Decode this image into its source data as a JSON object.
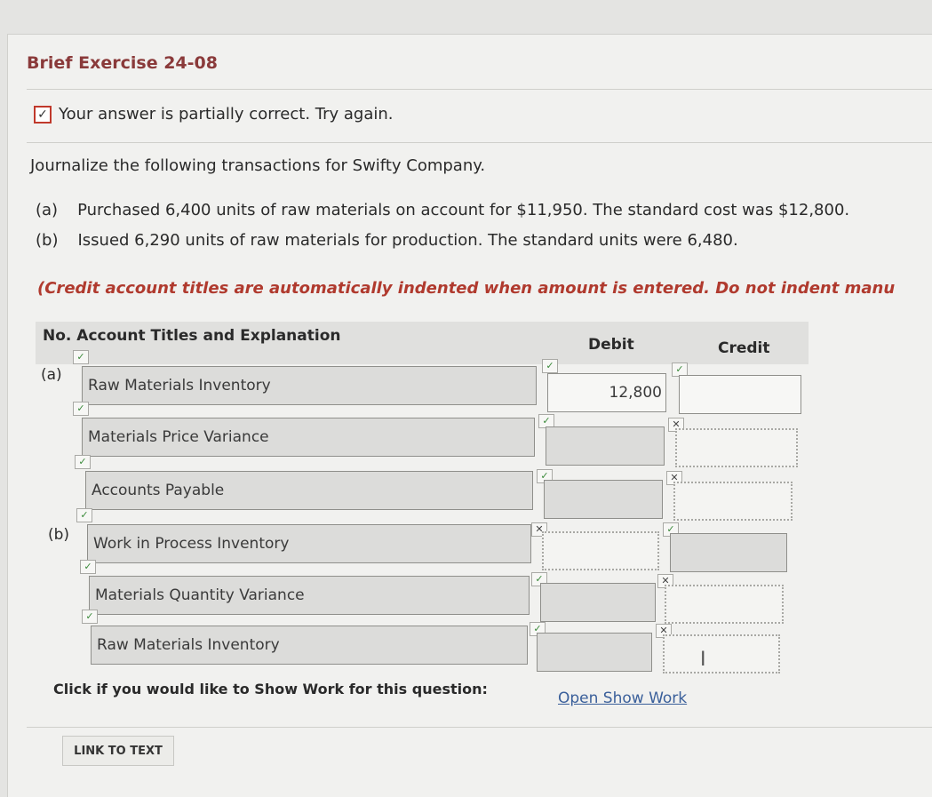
{
  "title": "Brief Exercise 24-08",
  "status": {
    "icon": "partial-check-icon",
    "text": "Your answer is partially correct.  Try again."
  },
  "prompt": "Journalize the following transactions for Swifty Company.",
  "items": [
    {
      "label": "(a)",
      "text": "Purchased 6,400 units of raw materials on account for $11,950. The standard cost was $12,800."
    },
    {
      "label": "(b)",
      "text": "Issued 6,290 units of raw materials for production. The standard units were 6,480."
    }
  ],
  "note": "(Credit account titles are automatically indented when amount is entered. Do not indent manu",
  "table": {
    "headers": {
      "account": "No. Account Titles and Explanation",
      "debit": "Debit",
      "credit": "Credit"
    },
    "rows": [
      {
        "no": "(a)",
        "account": "Raw Materials Inventory",
        "debit": "12,800",
        "credit": "",
        "acct_check": "✓",
        "debit_check": "✓",
        "credit_check": "✓"
      },
      {
        "no": "",
        "account": "Materials Price Variance",
        "debit": "",
        "credit": "",
        "acct_check": "✓",
        "debit_check": "✓",
        "credit_check": "✕"
      },
      {
        "no": "",
        "account": "Accounts Payable",
        "debit": "",
        "credit": "",
        "acct_check": "✓",
        "debit_check": "✓",
        "credit_check": "✕"
      },
      {
        "no": "(b)",
        "account": "Work in Process Inventory",
        "debit": "",
        "credit": "",
        "acct_check": "✓",
        "debit_check": "✕",
        "credit_check": "✓"
      },
      {
        "no": "",
        "account": "Materials Quantity Variance",
        "debit": "",
        "credit": "",
        "acct_check": "✓",
        "debit_check": "✓",
        "credit_check": "✕"
      },
      {
        "no": "",
        "account": "Raw Materials Inventory",
        "debit": "",
        "credit": "",
        "acct_check": "✓",
        "debit_check": "✓",
        "credit_check": "✕"
      }
    ]
  },
  "show_work": {
    "prompt": "Click if you would like to Show Work for this question:",
    "link": "Open Show Work"
  },
  "link_to_text": "LINK TO TEXT"
}
